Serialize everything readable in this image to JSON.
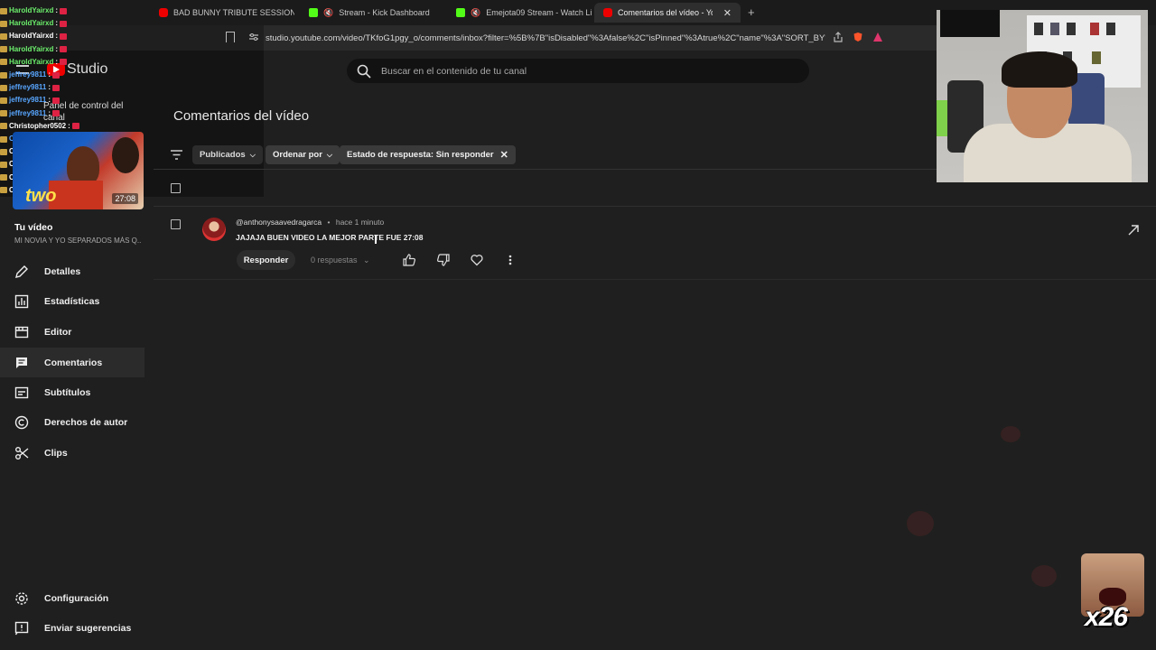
{
  "browser": {
    "tabs": [
      {
        "label": "BAD BUNNY TRIBUTE SESSION | DtM",
        "favicon": "youtube-icon"
      },
      {
        "label": "Stream - Kick Dashboard",
        "favicon": "kick-icon"
      },
      {
        "label": "Emejota09 Stream - Watch Live o",
        "favicon": "kick-icon"
      },
      {
        "label": "Comentarios del vídeo - YouTub",
        "favicon": "youtube-icon",
        "active": true
      }
    ],
    "new_tab": "+",
    "url": "studio.youtube.com/video/TKfoG1pgy_o/comments/inbox?filter=%5B%7B\"isDisabled\"%3Afalse%2C\"isPinned\"%3Atrue%2C\"name\"%3A\"SORT_BY\"%2..."
  },
  "header": {
    "logo": "Studio",
    "search_placeholder": "Buscar en el contenido de tu canal"
  },
  "overlay": {
    "chat": [
      {
        "name": "HaroldYairxd",
        "color": "green"
      },
      {
        "name": "HaroldYairxd",
        "color": "green"
      },
      {
        "name": "HaroldYairxd",
        "color": "white"
      },
      {
        "name": "HaroldYairxd",
        "color": "green"
      },
      {
        "name": "HaroldYairxd",
        "color": "green"
      },
      {
        "name": "jeffrey9811",
        "color": "blue"
      },
      {
        "name": "jeffrey9811",
        "color": "blue"
      },
      {
        "name": "jeffrey9811",
        "color": "blue"
      },
      {
        "name": "jeffrey9811",
        "color": "blue"
      },
      {
        "name": "Christopher0502",
        "color": "white"
      },
      {
        "name": "Christopher0502",
        "color": "blue"
      },
      {
        "name": "Christopher0502",
        "color": "white"
      },
      {
        "name": "Christopher0502",
        "color": "white"
      },
      {
        "name": "Christopher0502",
        "color": "white"
      },
      {
        "name": "Christopher0502",
        "color": "white"
      }
    ],
    "emote_count": "x26"
  },
  "sidebar": {
    "panel_label": "Panel de control del canal",
    "thumbnail_duration": "27:08",
    "thumbnail_text": "two",
    "video_heading": "Tu vídeo",
    "video_title": "MI NOVIA Y YO SEPARADOS MÁS Q...",
    "items": [
      {
        "label": "Detalles",
        "icon": "pencil-icon"
      },
      {
        "label": "Estadísticas",
        "icon": "analytics-icon"
      },
      {
        "label": "Editor",
        "icon": "editor-icon"
      },
      {
        "label": "Comentarios",
        "icon": "comments-icon",
        "active": true
      },
      {
        "label": "Subtítulos",
        "icon": "subtitles-icon"
      },
      {
        "label": "Derechos de autor",
        "icon": "copyright-icon"
      },
      {
        "label": "Clips",
        "icon": "scissors-icon"
      }
    ],
    "bottom": [
      {
        "label": "Configuración",
        "icon": "gear-icon"
      },
      {
        "label": "Enviar sugerencias",
        "icon": "feedback-icon"
      }
    ]
  },
  "main": {
    "title": "Comentarios del vídeo",
    "filters": {
      "published": "Publicados",
      "sort": "Ordenar por",
      "response_state": "Estado de respuesta: Sin responder"
    },
    "comments": [
      {
        "author": "@anthonysaavedragarca",
        "time": "hace 1 minuto",
        "text": "JAJAJA BUEN VIDEO LA MEJOR PARTE FUE 27:08",
        "reply_label": "Responder",
        "replies": "0 respuestas"
      }
    ]
  },
  "colors": {
    "background": "#1f1f1f",
    "sidebar_active": "#2b2b2b",
    "youtube_red": "#ff0000",
    "kick_green": "#53fc18"
  }
}
